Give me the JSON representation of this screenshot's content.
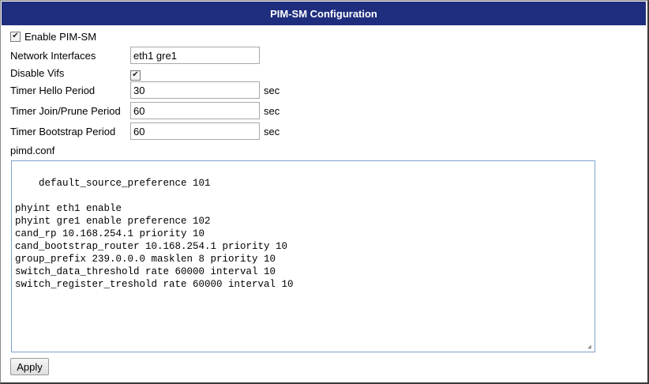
{
  "header": {
    "title": "PIM-SM Configuration"
  },
  "form": {
    "enable_pimsm": {
      "label": "Enable PIM-SM",
      "checked": true
    },
    "network_interfaces": {
      "label": "Network Interfaces",
      "value": "eth1 gre1"
    },
    "disable_vifs": {
      "label": "Disable Vifs",
      "checked": true
    },
    "hello_period": {
      "label": "Timer Hello Period",
      "value": "30",
      "unit": "sec"
    },
    "join_prune_period": {
      "label": "Timer Join/Prune Period",
      "value": "60",
      "unit": "sec"
    },
    "bootstrap_period": {
      "label": "Timer Bootstrap Period",
      "value": "60",
      "unit": "sec"
    },
    "pimd_conf": {
      "label": "pimd.conf",
      "content": "default_source_preference 101\n\nphyint eth1 enable\nphyint gre1 enable preference 102\ncand_rp 10.168.254.1 priority 10\ncand_bootstrap_router 10.168.254.1 priority 10\ngroup_prefix 239.0.0.0 masklen 8 priority 10\nswitch_data_threshold rate 60000 interval 10\nswitch_register_treshold rate 60000 interval 10"
    }
  },
  "actions": {
    "apply_label": "Apply"
  },
  "icons": {
    "checkbox_checked": "check-icon",
    "resize": "resize-grip-icon"
  }
}
